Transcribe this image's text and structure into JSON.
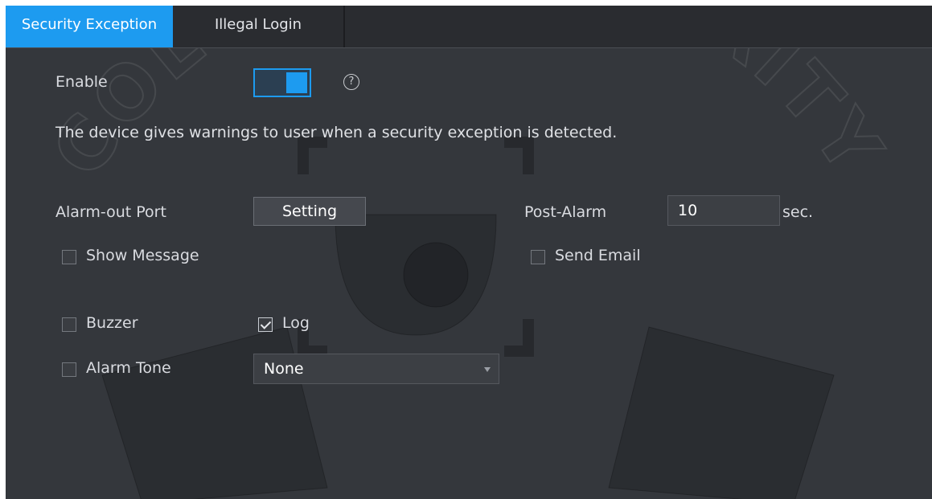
{
  "tabs": [
    {
      "label": "Security Exception",
      "active": true
    },
    {
      "label": "Illegal Login",
      "active": false
    }
  ],
  "enable": {
    "label": "Enable",
    "on": true,
    "help_icon": "question-circle-icon",
    "help_glyph": "?"
  },
  "description": "The device gives warnings to user when a security exception is detected.",
  "alarm_out": {
    "label": "Alarm-out Port",
    "button": "Setting"
  },
  "post_alarm": {
    "label": "Post-Alarm",
    "value": "10",
    "unit": "sec."
  },
  "options": {
    "show_message": {
      "label": "Show Message",
      "checked": false
    },
    "send_email": {
      "label": "Send Email",
      "checked": false
    },
    "buzzer": {
      "label": "Buzzer",
      "checked": false
    },
    "log": {
      "label": "Log",
      "checked": true
    },
    "alarm_tone": {
      "label": "Alarm Tone",
      "checked": false,
      "selected": "None"
    }
  },
  "watermark": {
    "text": "COLLSAM SECURITY",
    "icon": "security-camera-icon"
  },
  "colors": {
    "accent": "#1d9bf0",
    "background": "#34373c"
  }
}
